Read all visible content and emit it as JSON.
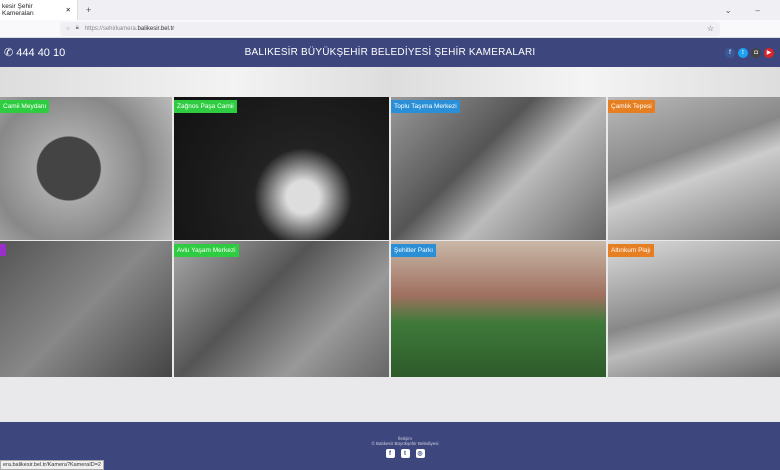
{
  "browser": {
    "tab_title": "kesir Şehir Kameraları",
    "url_prefix": "https://sehirkamera.",
    "url_domain": "balikesir.bel.tr",
    "status_url": "era.balikesir.bel.tr/Kamera?KameraID=2"
  },
  "header": {
    "phone": "444 40 10",
    "title": "BALIKESİR BÜYÜKŞEHİR BELEDİYESİ ŞEHİR KAMERALARI",
    "social": [
      {
        "icon": "facebook-icon",
        "color": "#3b5998",
        "g": "f"
      },
      {
        "icon": "twitter-icon",
        "color": "#1da1f2",
        "g": "t"
      },
      {
        "icon": "instagram-icon",
        "color": "#444",
        "g": "◘"
      },
      {
        "icon": "youtube-icon",
        "color": "#d9252a",
        "g": "▶"
      }
    ]
  },
  "cameras": [
    {
      "label": "Camii Meydanı",
      "color": "#2ecc40"
    },
    {
      "label": "Zağnos Paşa Camii",
      "color": "#2ecc40"
    },
    {
      "label": "Toplu Taşıma Merkezi",
      "color": "#2a8fd6"
    },
    {
      "label": "Çamlık Tepesi",
      "color": "#e67e22"
    },
    {
      "label": "",
      "color": "#9b30c8"
    },
    {
      "label": "Avlu Yaşam Merkezi",
      "color": "#2ecc40"
    },
    {
      "label": "Şehitler Parkı",
      "color": "#2a8fd6"
    },
    {
      "label": "Altınkum Plajı",
      "color": "#e67e22"
    }
  ],
  "footer": {
    "contact": "İletişim",
    "copyright": "© Balıkesir Büyükşehir Belediyesi"
  }
}
